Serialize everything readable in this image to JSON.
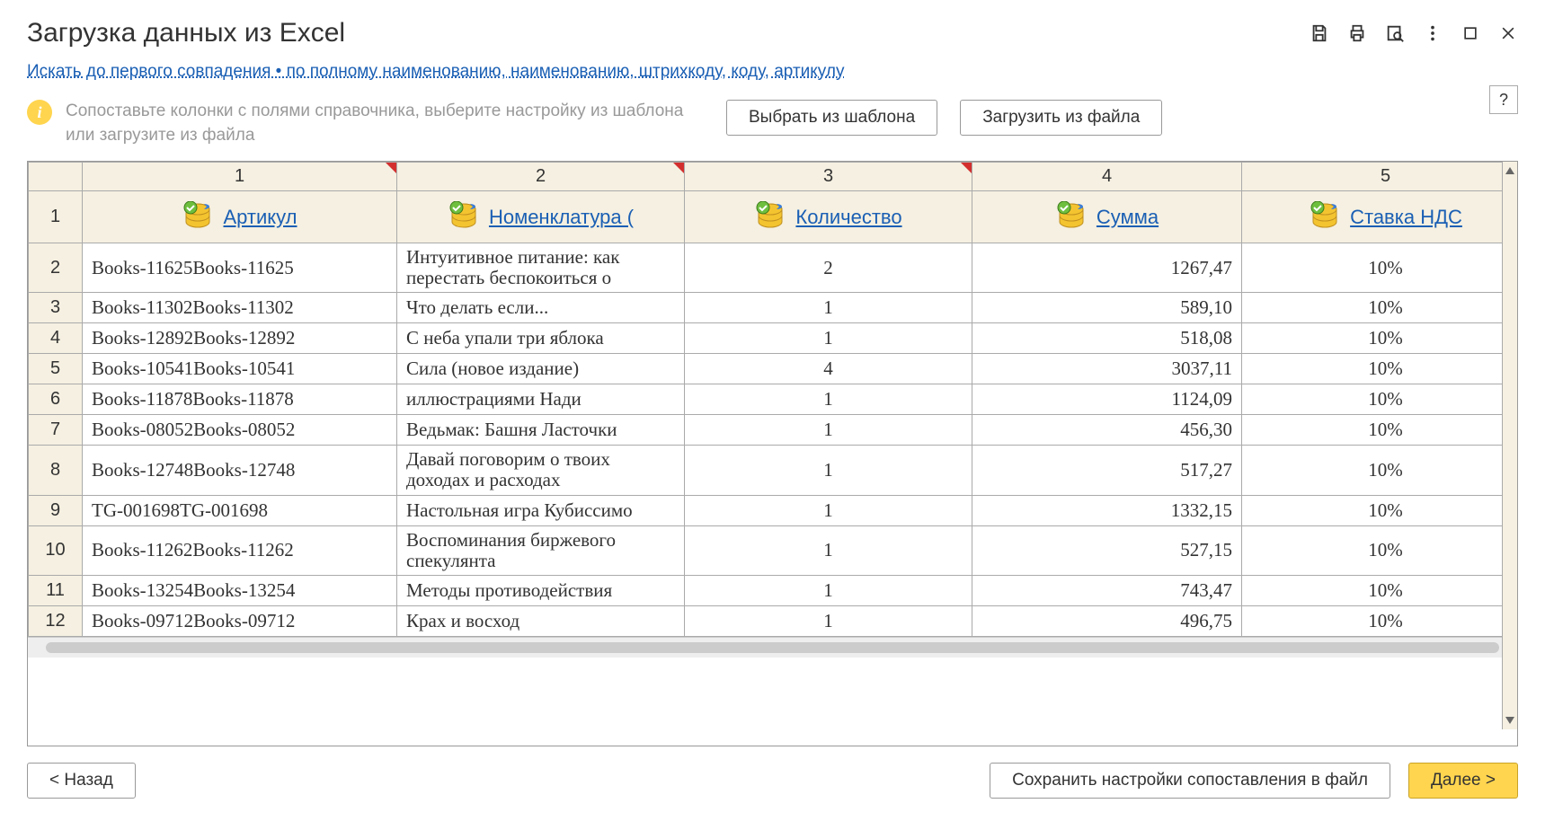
{
  "title": "Загрузка данных из Excel",
  "link_text": "Искать до первого совпадения • по полному наименованию, наименованию, штрихкоду, коду, артикулу",
  "hint": "Сопоставьте колонки с полями справочника, выберите настройку из шаблона или загрузите из файла",
  "buttons": {
    "template": "Выбрать из шаблона",
    "file": "Загрузить из файла",
    "back": "< Назад",
    "save": "Сохранить настройки сопоставления в файл",
    "next": "Далее >",
    "help": "?"
  },
  "columns": {
    "nums": [
      "1",
      "2",
      "3",
      "4",
      "5"
    ],
    "fields": [
      "Артикул",
      "Номенклатура (",
      "Количество",
      "Сумма",
      "Ставка НДС"
    ]
  },
  "rows": [
    {
      "n": "2",
      "art": "Books-11625Books-11625",
      "name": "Интуитивное питание: как перестать беспокоиться о",
      "qty": "2",
      "sum": "1267,47",
      "vat": "10%"
    },
    {
      "n": "3",
      "art": "Books-11302Books-11302",
      "name": "Что делать если...",
      "qty": "1",
      "sum": "589,10",
      "vat": "10%"
    },
    {
      "n": "4",
      "art": "Books-12892Books-12892",
      "name": "С неба упали три яблока",
      "qty": "1",
      "sum": "518,08",
      "vat": "10%"
    },
    {
      "n": "5",
      "art": "Books-10541Books-10541",
      "name": "Сила (новое издание)",
      "qty": "4",
      "sum": "3037,11",
      "vat": "10%"
    },
    {
      "n": "6",
      "art": "Books-11878Books-11878",
      "name": "иллюстрациями Нади",
      "qty": "1",
      "sum": "1124,09",
      "vat": "10%"
    },
    {
      "n": "7",
      "art": "Books-08052Books-08052",
      "name": "Ведьмак: Башня Ласточки",
      "qty": "1",
      "sum": "456,30",
      "vat": "10%"
    },
    {
      "n": "8",
      "art": "Books-12748Books-12748",
      "name": "Давай поговорим о твоих доходах и расходах",
      "qty": "1",
      "sum": "517,27",
      "vat": "10%"
    },
    {
      "n": "9",
      "art": "TG-001698TG-001698",
      "name": "Настольная игра Кубиссимо",
      "qty": "1",
      "sum": "1332,15",
      "vat": "10%"
    },
    {
      "n": "10",
      "art": "Books-11262Books-11262",
      "name": "Воспоминания биржевого спекулянта",
      "qty": "1",
      "sum": "527,15",
      "vat": "10%"
    },
    {
      "n": "11",
      "art": "Books-13254Books-13254",
      "name": "Методы противодействия",
      "qty": "1",
      "sum": "743,47",
      "vat": "10%"
    },
    {
      "n": "12",
      "art": "Books-09712Books-09712",
      "name": "Крах и восход",
      "qty": "1",
      "sum": "496,75",
      "vat": "10%"
    }
  ],
  "icons": {
    "info": "i"
  }
}
